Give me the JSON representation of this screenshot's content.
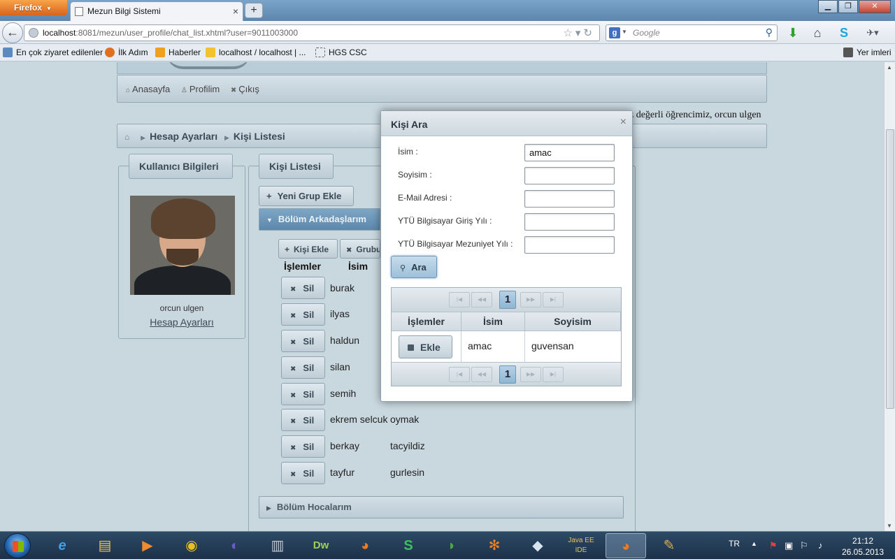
{
  "browser": {
    "menu_button": "Firefox",
    "tab_title": "Mezun Bilgi Sistemi",
    "url_host": "localhost",
    "url_rest": ":8081/mezun/user_profile/chat_list.xhtml?user=9011003000",
    "search_placeholder": "Google",
    "bookmarks": [
      "En çok ziyaret edilenler",
      "İlk Adım",
      "Haberler",
      "localhost / localhost | ...",
      "HGS CSC"
    ],
    "bookmarks_right": "Yer imleri"
  },
  "menu": {
    "home": "Anasayfa",
    "profile": "Profilim",
    "logout": "Çıkış"
  },
  "welcome_text": "z değerli öğrencimiz, orcun ulgen",
  "breadcrumb": {
    "item1": "Hesap Ayarları",
    "item2": "Kişi Listesi"
  },
  "user_panel": {
    "title": "Kullanıcı Bilgileri",
    "name": "orcun ulgen",
    "settings_link": "Hesap Ayarları"
  },
  "contacts_panel": {
    "title": "Kişi Listesi",
    "new_group_button": "Yeni Grup Ekle",
    "group_active": "Bölüm Arkadaşlarım",
    "add_person_button": "Kişi Ekle",
    "delete_group_button": "Grubu Sil",
    "col_actions": "İşlemler",
    "col_name": "İsim",
    "delete_label": "Sil",
    "rows": [
      {
        "name": "burak",
        "surname": ""
      },
      {
        "name": "ilyas",
        "surname": ""
      },
      {
        "name": "haldun",
        "surname": ""
      },
      {
        "name": "silan",
        "surname": ""
      },
      {
        "name": "semih",
        "surname": ""
      },
      {
        "name": "ekrem selcuk",
        "surname": "oymak"
      },
      {
        "name": "berkay",
        "surname": "tacyildiz"
      },
      {
        "name": "tayfur",
        "surname": "gurlesin"
      }
    ],
    "group_closed": "Bölüm Hocalarım"
  },
  "dialog": {
    "title": "Kişi Ara",
    "close_icon": "×",
    "fields": [
      {
        "label": "İsim :",
        "value": "amac"
      },
      {
        "label": "Soyisim :",
        "value": ""
      },
      {
        "label": "E-Mail Adresi :",
        "value": ""
      },
      {
        "label": "YTÜ Bilgisayar Giriş Yılı :",
        "value": ""
      },
      {
        "label": "YTÜ Bilgisayar Mezuniyet Yılı :",
        "value": ""
      }
    ],
    "search_button": "Ara",
    "page": "1",
    "grid_headers": [
      "İşlemler",
      "İsim",
      "Soyisim"
    ],
    "result": {
      "action": "Ekle",
      "name": "amac",
      "surname": "guvensan"
    }
  },
  "taskbar": {
    "lang": "TR",
    "time": "21:12",
    "date": "26.05.2013"
  }
}
